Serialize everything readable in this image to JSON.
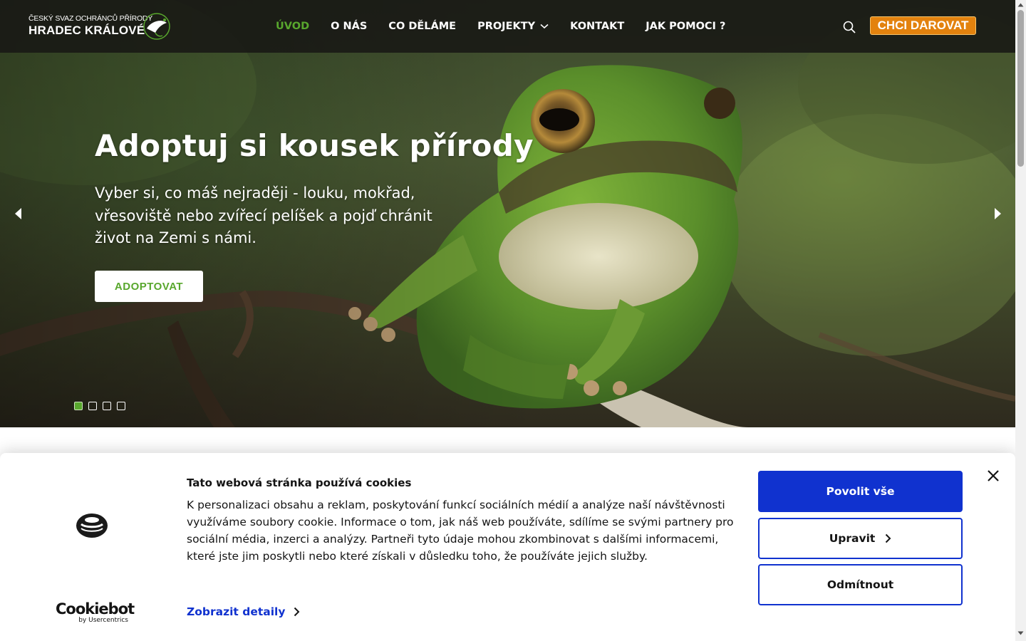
{
  "header": {
    "logo": {
      "line1": "ČESKÝ SVAZ OCHRÁNCŮ PŘÍRODY",
      "line2": "HRADEC KRÁLOVÉ"
    },
    "nav": [
      {
        "label": "ÚVOD",
        "active": true
      },
      {
        "label": "O NÁS",
        "active": false
      },
      {
        "label": "CO DĚLÁME",
        "active": false
      },
      {
        "label": "PROJEKTY",
        "active": false,
        "has_dropdown": true
      },
      {
        "label": "KONTAKT",
        "active": false
      },
      {
        "label": "JAK POMOCI ?",
        "active": false
      }
    ],
    "search_icon": "search-icon",
    "donate_label": "CHCI DAROVAT"
  },
  "hero": {
    "title": "Adoptuj si kousek přírody",
    "text": "Vyber si, co máš nejraději - louku, mokřad, vřesoviště nebo zvířecí pelíšek a pojď chránit život na Zemi s námi.",
    "button_label": "ADOPTOVAT",
    "slides_count": 4,
    "active_slide": 1,
    "prev_icon": "arrow-left-icon",
    "next_icon": "arrow-right-icon"
  },
  "cookie_banner": {
    "title": "Tato webová stránka používá cookies",
    "body": "K personalizaci obsahu a reklam, poskytování funkcí sociálních médií a analýze naší návštěvnosti využíváme soubory cookie. Informace o tom, jak náš web používáte, sdílíme se svými partnery pro sociální média, inzerci a analýzy. Partneři tyto údaje mohou zkombinovat s dalšími informacemi, které jste jim poskytli nebo které získali v důsledku toho, že používáte jejich služby.",
    "details_label": "Zobrazit detaily",
    "allow_all_label": "Povolit vše",
    "edit_label": "Upravit",
    "deny_label": "Odmítnout",
    "brand_name": "Cookiebot",
    "brand_sub": "by Usercentrics"
  },
  "colors": {
    "accent_green": "#58a72d",
    "donate_orange": "#e3820e",
    "cookie_blue": "#1032cf"
  }
}
